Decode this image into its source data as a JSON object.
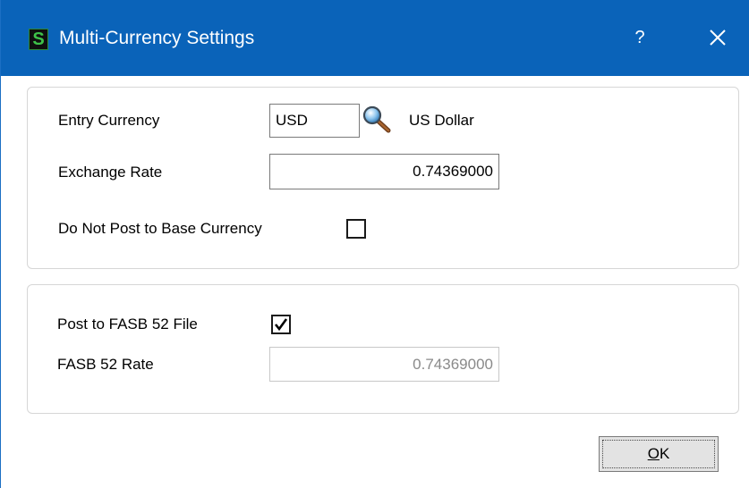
{
  "window": {
    "title": "Multi-Currency Settings",
    "app_icon_letter": "S",
    "help_label": "?",
    "close_icon": "close-icon",
    "titlebar_color": "#0a63b9"
  },
  "currency_group": {
    "entry_currency_label": "Entry Currency",
    "entry_currency_value": "USD",
    "lookup_icon": "magnifier-icon",
    "currency_description": "US Dollar",
    "exchange_rate_label": "Exchange Rate",
    "exchange_rate_value": "0.74369000",
    "do_not_post_label": "Do Not Post to Base Currency",
    "do_not_post_checked": false
  },
  "fasb_group": {
    "post_fasb_label": "Post to FASB 52 File",
    "post_fasb_checked": true,
    "fasb_rate_label": "FASB 52 Rate",
    "fasb_rate_value": "0.74369000"
  },
  "buttons": {
    "ok_mnemonic": "O",
    "ok_rest": "K"
  }
}
